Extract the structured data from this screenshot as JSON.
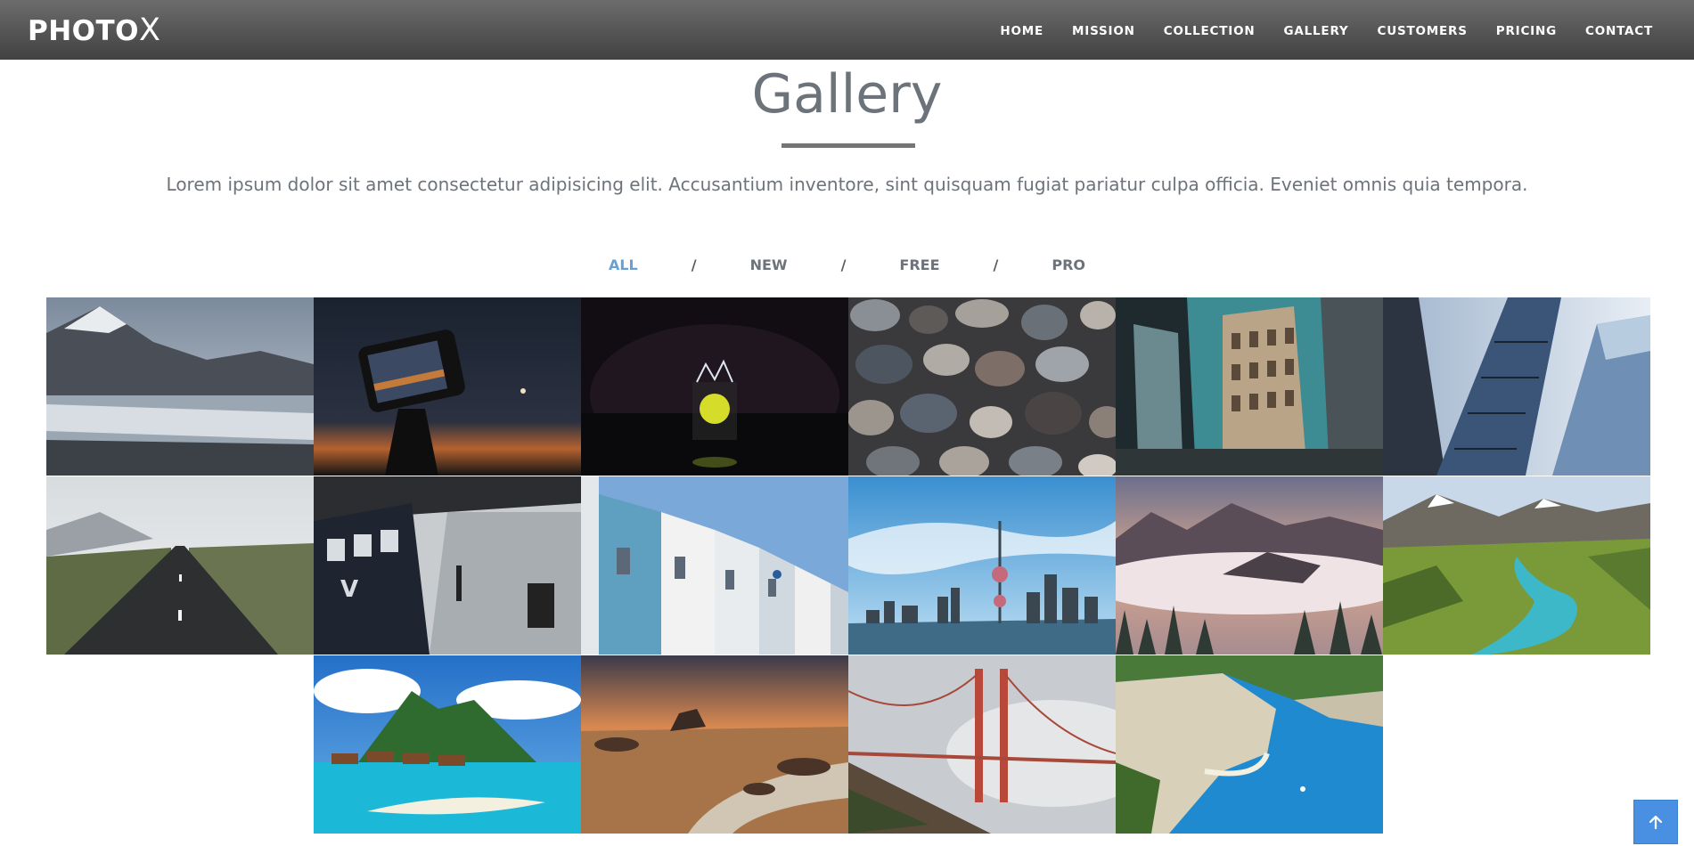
{
  "brand": {
    "text": "PHOTO",
    "accent": "X"
  },
  "nav": {
    "items": [
      "HOME",
      "MISSION",
      "COLLECTION",
      "GALLERY",
      "CUSTOMERS",
      "PRICING",
      "CONTACT"
    ]
  },
  "section": {
    "title": "Gallery",
    "lead": "Lorem ipsum dolor sit amet consectetur adipisicing elit. Accusantium inventore, sint quisquam fugiat pariatur culpa officia. Eveniet omnis quia tempora."
  },
  "filters": {
    "items": [
      "ALL",
      "NEW",
      "FREE",
      "PRO"
    ],
    "separator": "/",
    "active": "ALL"
  },
  "gallery": {
    "photos": [
      "mountain-lake-photo",
      "phone-tripod-photo",
      "lime-splash-photo",
      "pebbles-photo",
      "city-building-photo",
      "skyscraper-photo",
      "empty-road-photo",
      "train-station-photo",
      "white-houses-photo",
      "city-skyline-photo",
      "foggy-mountains-photo",
      "green-valley-photo",
      "tropical-island-photo",
      "beach-sunset-photo",
      "golden-gate-bridge-photo",
      "coastal-cove-photo"
    ]
  },
  "colors": {
    "navbar": "#555555",
    "title": "#6d737b",
    "accent": "#6a9fd4",
    "back_to_top": "#4a90e2"
  },
  "icons": {
    "back_to_top": "arrow-up-icon"
  }
}
